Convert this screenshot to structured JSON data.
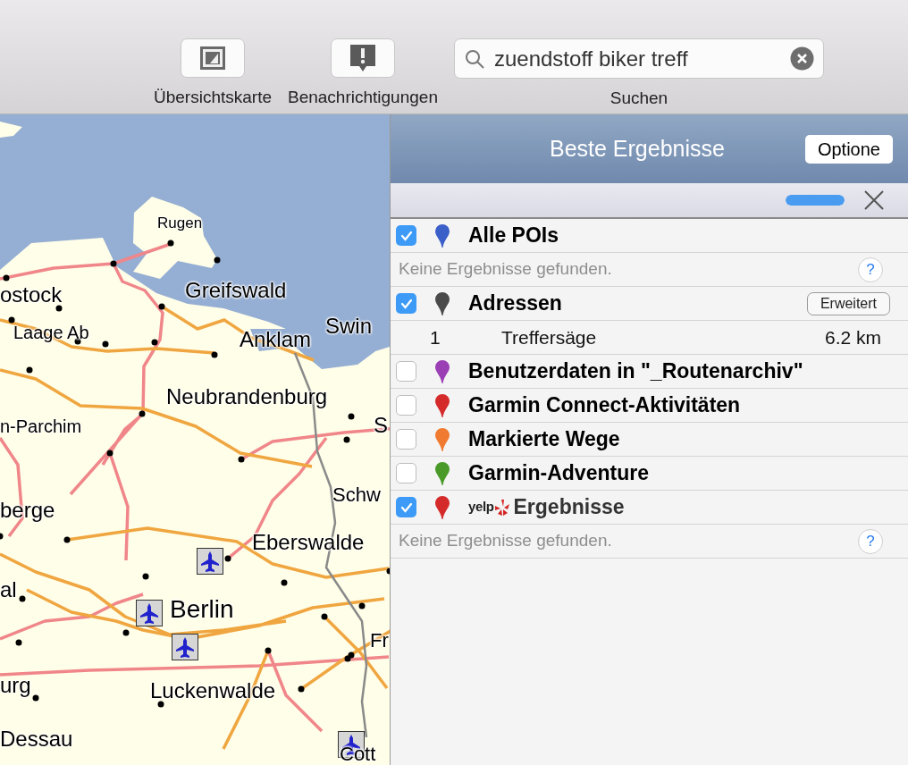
{
  "toolbar": {
    "buttons": [
      {
        "label": "Übersichtskarte",
        "kind": "overview"
      },
      {
        "label": "Benachrichtigungen",
        "kind": "alert"
      }
    ],
    "search": {
      "value": "zuendstoff biker treff",
      "label": "Suchen"
    }
  },
  "map": {
    "labels": [
      {
        "text": "Rugen"
      },
      {
        "text": "ostock"
      },
      {
        "text": "Greifswald"
      },
      {
        "text": "Laage Ab"
      },
      {
        "text": "Anklam"
      },
      {
        "text": "Swin"
      },
      {
        "text": "Neubrandenburg"
      },
      {
        "text": "n-Parchim"
      },
      {
        "text": "S"
      },
      {
        "text": "Schw"
      },
      {
        "text": "berge"
      },
      {
        "text": "Eberswalde"
      },
      {
        "text": "al"
      },
      {
        "text": "Berlin"
      },
      {
        "text": "Fr"
      },
      {
        "text": "urg"
      },
      {
        "text": "Luckenwalde"
      },
      {
        "text": "Dessau"
      },
      {
        "text": "Cott"
      }
    ]
  },
  "results": {
    "title": "Beste Ergebnisse",
    "options_button": "Optione",
    "progress": {
      "level": 1
    },
    "rows": [
      {
        "kind": "category",
        "checked": true,
        "color": "#3b5fc8",
        "label": "Alle POIs"
      },
      {
        "kind": "empty",
        "message": "Keine Ergebnisse gefunden.",
        "help": "?"
      },
      {
        "kind": "category",
        "checked": true,
        "color": "#4a4a4a",
        "label": "Adressen",
        "button": "Erweitert"
      },
      {
        "kind": "result",
        "index": "1",
        "name": "Treffersäge",
        "distance": "6.2 km"
      },
      {
        "kind": "category",
        "checked": false,
        "color": "#9b3fb5",
        "label": "Benutzerdaten in \"_Routenarchiv\""
      },
      {
        "kind": "category",
        "checked": false,
        "color": "#d42a2a",
        "label": "Garmin Connect-Aktivitäten"
      },
      {
        "kind": "category",
        "checked": false,
        "color": "#f07a30",
        "label": "Markierte Wege"
      },
      {
        "kind": "category",
        "checked": false,
        "color": "#4a9a2a",
        "label": "Garmin-Adventure"
      },
      {
        "kind": "category",
        "checked": true,
        "color": "#d42a2a",
        "label": "Ergebnisse",
        "logo": "yelp"
      },
      {
        "kind": "empty",
        "message": "Keine Ergebnisse gefunden.",
        "help": "?"
      }
    ]
  }
}
